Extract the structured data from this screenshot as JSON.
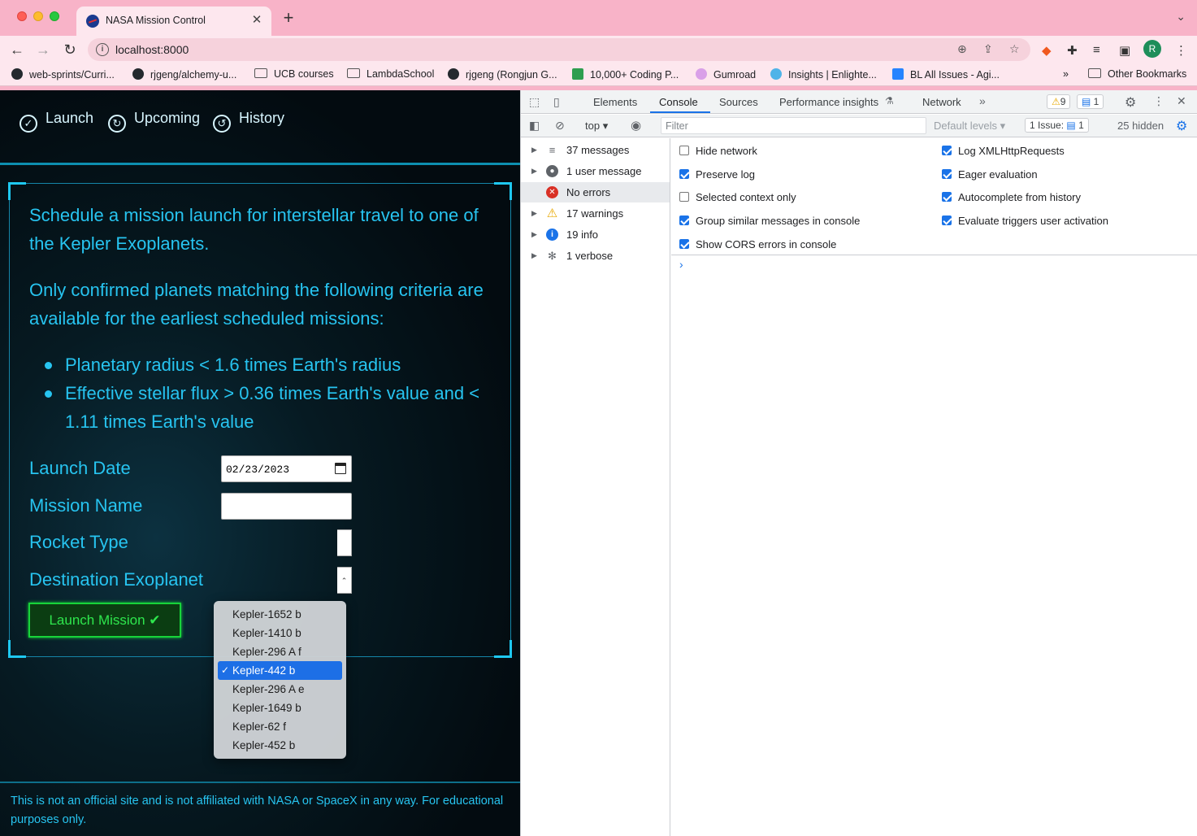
{
  "browser": {
    "tab_title": "NASA Mission Control",
    "tab_close": "✕",
    "new_tab": "+",
    "url": "localhost:8000",
    "avatar_letter": "R",
    "bookmarks": [
      "web-sprints/Curri...",
      "rjgeng/alchemy-u...",
      "UCB courses",
      "LambdaSchool",
      "rjgeng (Rongjun G...",
      "10,000+ Coding P...",
      "Gumroad",
      "Insights | Enlighte...",
      "BL All Issues - Agi...",
      "Other Bookmarks"
    ],
    "bookmarks_overflow": "»"
  },
  "app": {
    "nav": [
      "Launch",
      "Upcoming",
      "History"
    ],
    "intro_1": "Schedule a mission launch for interstellar travel to one of the Kepler Exoplanets.",
    "intro_2": "Only confirmed planets matching the following criteria are available for the earliest scheduled missions:",
    "criteria": [
      "Planetary radius < 1.6 times Earth's radius",
      "Effective stellar flux > 0.36 times Earth's value and < 1.11 times Earth's value"
    ],
    "form": {
      "launch_date_label": "Launch Date",
      "launch_date_value": "02/23/2023",
      "mission_name_label": "Mission Name",
      "rocket_type_label": "Rocket Type",
      "destination_label": "Destination Exoplanet",
      "destination_selected": "Kepler-442 b",
      "destination_options": [
        "Kepler-1652 b",
        "Kepler-1410 b",
        "Kepler-296 A f",
        "Kepler-442 b",
        "Kepler-296 A e",
        "Kepler-1649 b",
        "Kepler-62 f",
        "Kepler-452 b"
      ],
      "submit_label": "Launch Mission ✔"
    },
    "footer": "This is not an official site and is not affiliated with NASA or SpaceX in any way. For educational purposes only."
  },
  "devtools": {
    "tabs": [
      "Elements",
      "Console",
      "Sources",
      "Performance insights",
      "Network"
    ],
    "active_tab": "Console",
    "warning_count": "9",
    "message_count": "1",
    "context": "top",
    "filter_placeholder": "Filter",
    "levels": "Default levels",
    "issues": "1 Issue:",
    "issues_count": "1",
    "hidden": "25 hidden",
    "sidebar": [
      {
        "label": "37 messages",
        "icon": "list-icon"
      },
      {
        "label": "1 user message",
        "icon": "user-icon"
      },
      {
        "label": "No errors",
        "icon": "error-icon"
      },
      {
        "label": "17 warnings",
        "icon": "warning-icon"
      },
      {
        "label": "19 info",
        "icon": "info-icon"
      },
      {
        "label": "1 verbose",
        "icon": "bug-icon"
      }
    ],
    "options_left": [
      {
        "label": "Hide network",
        "checked": false
      },
      {
        "label": "Preserve log",
        "checked": true
      },
      {
        "label": "Selected context only",
        "checked": false
      },
      {
        "label": "Group similar messages in console",
        "checked": true
      },
      {
        "label": "Show CORS errors in console",
        "checked": true
      }
    ],
    "options_right": [
      {
        "label": "Log XMLHttpRequests",
        "checked": true
      },
      {
        "label": "Eager evaluation",
        "checked": true
      },
      {
        "label": "Autocomplete from history",
        "checked": true
      },
      {
        "label": "Evaluate triggers user activation",
        "checked": true
      }
    ],
    "prompt": "›"
  }
}
